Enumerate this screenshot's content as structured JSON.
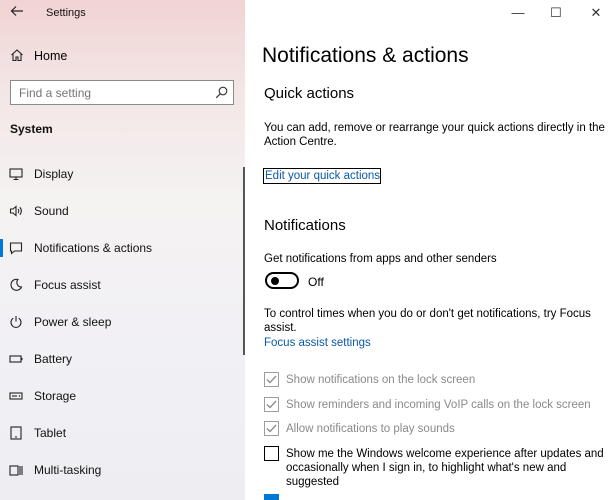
{
  "window": {
    "title": "Settings",
    "controls": {
      "minimize": "—",
      "maximize": "☐",
      "close": "✕"
    }
  },
  "sidebar": {
    "home_label": "Home",
    "search_placeholder": "Find a setting",
    "section_label": "System",
    "items": [
      {
        "label": "Display",
        "icon": "monitor-icon"
      },
      {
        "label": "Sound",
        "icon": "speaker-icon"
      },
      {
        "label": "Notifications & actions",
        "icon": "notification-icon",
        "selected": true
      },
      {
        "label": "Focus assist",
        "icon": "moon-icon"
      },
      {
        "label": "Power & sleep",
        "icon": "power-icon"
      },
      {
        "label": "Battery",
        "icon": "battery-icon"
      },
      {
        "label": "Storage",
        "icon": "storage-icon"
      },
      {
        "label": "Tablet",
        "icon": "tablet-icon"
      },
      {
        "label": "Multi-tasking",
        "icon": "multitasking-icon"
      }
    ]
  },
  "main": {
    "page_title": "Notifications & actions",
    "quick_actions": {
      "heading": "Quick actions",
      "description": "You can add, remove or rearrange your quick actions directly in the Action Centre.",
      "link": "Edit your quick actions"
    },
    "notifications": {
      "heading": "Notifications",
      "toggle_label": "Get notifications from apps and other senders",
      "toggle_state": "Off",
      "toggle_on": false,
      "focus_text": "To control times when you do or don't get notifications, try Focus assist.",
      "focus_link": "Focus assist settings",
      "checkboxes": [
        {
          "label": "Show notifications on the lock screen",
          "checked": true,
          "disabled": true
        },
        {
          "label": "Show reminders and incoming VoIP calls on the lock screen",
          "checked": true,
          "disabled": true
        },
        {
          "label": "Allow notifications to play sounds",
          "checked": true,
          "disabled": true
        },
        {
          "label": "Show me the Windows welcome experience after updates and occasionally when I sign in, to highlight what's new and suggested",
          "checked": false,
          "disabled": false
        },
        {
          "label": "",
          "checked": true,
          "disabled": false
        }
      ]
    }
  },
  "colors": {
    "accent": "#0078d7",
    "link": "#0a58a6",
    "disabled_text": "#8a8a8a"
  }
}
